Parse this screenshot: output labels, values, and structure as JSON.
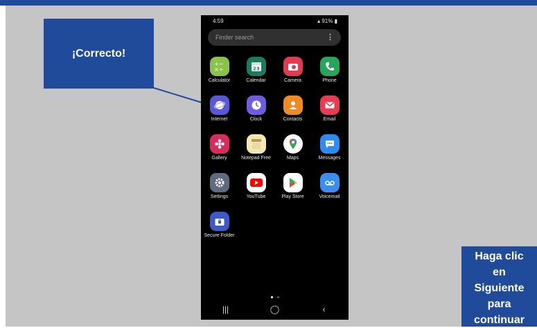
{
  "callout": {
    "text": "¡Correcto!"
  },
  "instruction": {
    "lines": [
      "Haga clic",
      "en",
      "Siguiente",
      "para",
      "continuar"
    ]
  },
  "phone": {
    "status": {
      "time": "4:59",
      "battery": "91%"
    },
    "search": {
      "placeholder": "Finder search"
    },
    "apps": [
      {
        "label": "Calculator",
        "icon": "calculator-icon",
        "color": "#8bc34a"
      },
      {
        "label": "Calendar",
        "icon": "calendar-icon",
        "color": "#1e7a5c"
      },
      {
        "label": "Camera",
        "icon": "camera-icon",
        "color": "#e53950"
      },
      {
        "label": "Phone",
        "icon": "phone-icon",
        "color": "#27a55a"
      },
      {
        "label": "Internet",
        "icon": "internet-icon",
        "color": "#5a57d9"
      },
      {
        "label": "Clock",
        "icon": "clock-icon",
        "color": "#6f5ce0"
      },
      {
        "label": "Contacts",
        "icon": "contacts-icon",
        "color": "#f08a24"
      },
      {
        "label": "Email",
        "icon": "email-icon",
        "color": "#ea3b53"
      },
      {
        "label": "Gallery",
        "icon": "gallery-icon",
        "color": "#d82c5e"
      },
      {
        "label": "Notepad Free",
        "icon": "notepad-icon",
        "color": "#f4e7b2"
      },
      {
        "label": "Maps",
        "icon": "maps-icon",
        "color": "#ffffff"
      },
      {
        "label": "Messages",
        "icon": "messages-icon",
        "color": "#2d8cf0"
      },
      {
        "label": "Settings",
        "icon": "settings-icon",
        "color": "#5e6a7d"
      },
      {
        "label": "YouTube",
        "icon": "youtube-icon",
        "color": "#ffffff"
      },
      {
        "label": "Play Store",
        "icon": "play-store-icon",
        "color": "#ffffff"
      },
      {
        "label": "Voicemail",
        "icon": "voicemail-icon",
        "color": "#3b8ef0"
      },
      {
        "label": "Secure Folder",
        "icon": "secure-folder-icon",
        "color": "#3d5ac8"
      }
    ],
    "page_indicator": {
      "pages": 2,
      "current": 1
    }
  }
}
